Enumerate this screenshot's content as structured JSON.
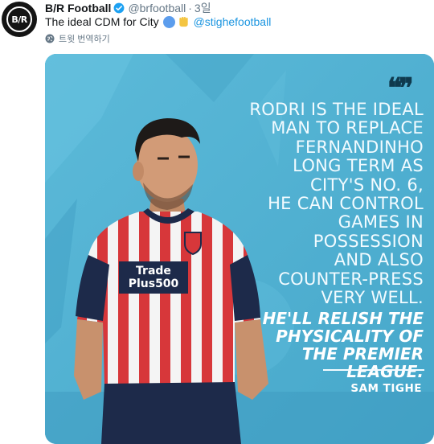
{
  "tweet": {
    "author_name": "B/R Football",
    "avatar_text": "B/R",
    "handle": "@brfootball",
    "separator": "·",
    "time": "3일",
    "text": "The ideal CDM for City",
    "emoji_icons": [
      "blue-circle-emoji",
      "raised-fist-emoji"
    ],
    "mention": "@stighefootball",
    "translate_label": "트윗 번역하기"
  },
  "image": {
    "quote_mark": "❝❞",
    "quote_lines": [
      "RODRI IS THE IDEAL",
      "MAN TO REPLACE",
      "FERNANDINHO",
      "LONG TERM AS",
      "CITY'S NO. 6,",
      "HE CAN CONTROL",
      "GAMES IN",
      "POSSESSION",
      "AND ALSO",
      "COUNTER-PRESS",
      "VERY WELL."
    ],
    "emphasis_lines": [
      "HE'LL RELISH THE",
      "PHYSICALITY OF",
      "THE PREMIER",
      "LEAGUE."
    ],
    "quote_author": "SAM TIGHE",
    "shirt_sponsor_top": "Trade",
    "shirt_sponsor_bottom": "Plus500",
    "colors": {
      "background": "#4fb1d3",
      "shirt_red": "#d7373a",
      "shirt_white": "#f4f4f4",
      "shorts_navy": "#1d2a4a"
    }
  }
}
